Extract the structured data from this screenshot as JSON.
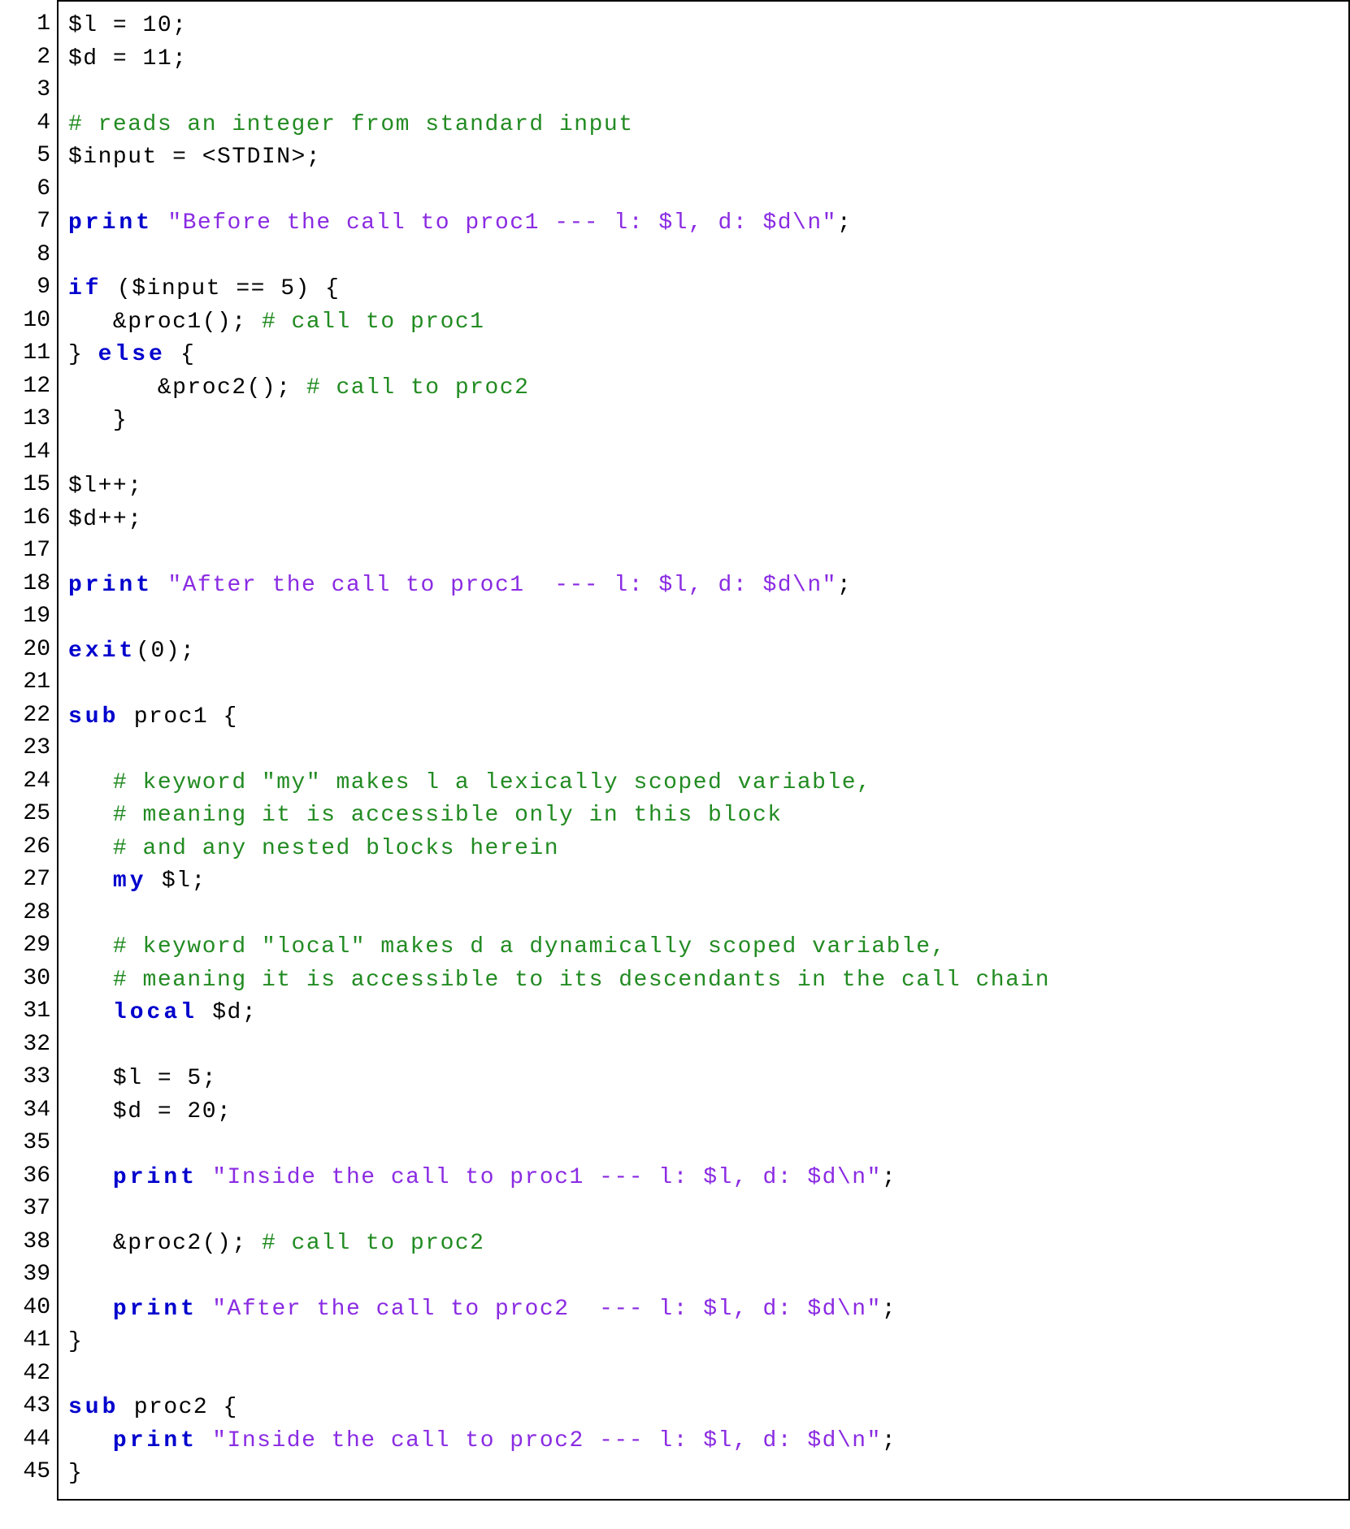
{
  "code": {
    "lineCount": 45,
    "lines": [
      [
        {
          "t": "$l = 10;"
        }
      ],
      [
        {
          "t": "$d = 11;"
        }
      ],
      [],
      [
        {
          "t": "# reads an integer from standard input",
          "c": "cm"
        }
      ],
      [
        {
          "t": "$input = <STDIN>;"
        }
      ],
      [],
      [
        {
          "t": "print",
          "c": "kw"
        },
        {
          "t": " "
        },
        {
          "t": "\"Before the call to proc1 --- l: $l, d: $d\\n\"",
          "c": "st"
        },
        {
          "t": ";"
        }
      ],
      [],
      [
        {
          "t": "if",
          "c": "kw"
        },
        {
          "t": " ($input == 5) {"
        }
      ],
      [
        {
          "t": "   &proc1(); "
        },
        {
          "t": "# call to proc1",
          "c": "cm"
        }
      ],
      [
        {
          "t": "} "
        },
        {
          "t": "else",
          "c": "kw"
        },
        {
          "t": " {"
        }
      ],
      [
        {
          "t": "      &proc2(); "
        },
        {
          "t": "# call to proc2",
          "c": "cm"
        }
      ],
      [
        {
          "t": "   }"
        }
      ],
      [],
      [
        {
          "t": "$l++;"
        }
      ],
      [
        {
          "t": "$d++;"
        }
      ],
      [],
      [
        {
          "t": "print",
          "c": "kw"
        },
        {
          "t": " "
        },
        {
          "t": "\"After the call to proc1  --- l: $l, d: $d\\n\"",
          "c": "st"
        },
        {
          "t": ";"
        }
      ],
      [],
      [
        {
          "t": "exit",
          "c": "kw"
        },
        {
          "t": "(0);"
        }
      ],
      [],
      [
        {
          "t": "sub",
          "c": "kw"
        },
        {
          "t": " proc1 {"
        }
      ],
      [],
      [
        {
          "t": "   "
        },
        {
          "t": "# keyword \"my\" makes l a lexically scoped variable,",
          "c": "cm"
        }
      ],
      [
        {
          "t": "   "
        },
        {
          "t": "# meaning it is accessible only in this block",
          "c": "cm"
        }
      ],
      [
        {
          "t": "   "
        },
        {
          "t": "# and any nested blocks herein",
          "c": "cm"
        }
      ],
      [
        {
          "t": "   "
        },
        {
          "t": "my",
          "c": "kw"
        },
        {
          "t": " $l;"
        }
      ],
      [],
      [
        {
          "t": "   "
        },
        {
          "t": "# keyword \"local\" makes d a dynamically scoped variable,",
          "c": "cm"
        }
      ],
      [
        {
          "t": "   "
        },
        {
          "t": "# meaning it is accessible to its descendants in the call chain",
          "c": "cm"
        }
      ],
      [
        {
          "t": "   "
        },
        {
          "t": "local",
          "c": "kw"
        },
        {
          "t": " $d;"
        }
      ],
      [],
      [
        {
          "t": "   $l = 5;"
        }
      ],
      [
        {
          "t": "   $d = 20;"
        }
      ],
      [],
      [
        {
          "t": "   "
        },
        {
          "t": "print",
          "c": "kw"
        },
        {
          "t": " "
        },
        {
          "t": "\"Inside the call to proc1 --- l: $l, d: $d\\n\"",
          "c": "st"
        },
        {
          "t": ";"
        }
      ],
      [],
      [
        {
          "t": "   &proc2(); "
        },
        {
          "t": "# call to proc2",
          "c": "cm"
        }
      ],
      [],
      [
        {
          "t": "   "
        },
        {
          "t": "print",
          "c": "kw"
        },
        {
          "t": " "
        },
        {
          "t": "\"After the call to proc2  --- l: $l, d: $d\\n\"",
          "c": "st"
        },
        {
          "t": ";"
        }
      ],
      [
        {
          "t": "}"
        }
      ],
      [],
      [
        {
          "t": "sub",
          "c": "kw"
        },
        {
          "t": " proc2 {"
        }
      ],
      [
        {
          "t": "   "
        },
        {
          "t": "print",
          "c": "kw"
        },
        {
          "t": " "
        },
        {
          "t": "\"Inside the call to proc2 --- l: $l, d: $d\\n\"",
          "c": "st"
        },
        {
          "t": ";"
        }
      ],
      [
        {
          "t": "}"
        }
      ]
    ]
  }
}
